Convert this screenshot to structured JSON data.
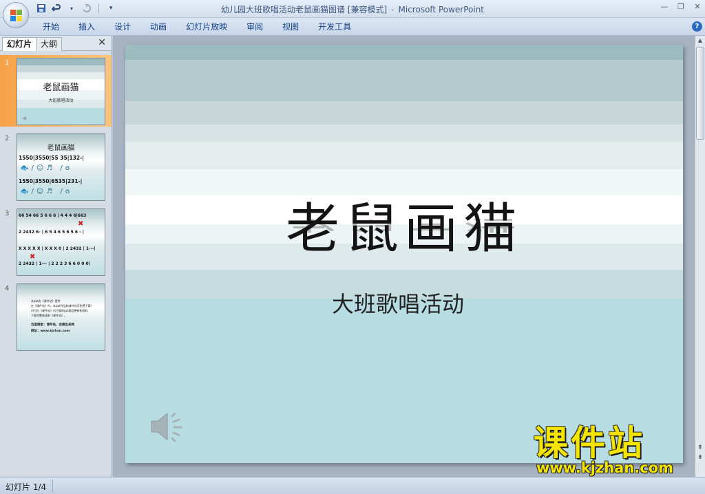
{
  "window": {
    "title": "幼儿园大班歌唱活动老鼠画猫图谱 [兼容模式]",
    "app_name": "Microsoft PowerPoint",
    "separator": "-"
  },
  "qat": {
    "customize_glyph": "▾"
  },
  "ribbon": {
    "tabs": [
      {
        "label": "开始"
      },
      {
        "label": "插入"
      },
      {
        "label": "设计"
      },
      {
        "label": "动画"
      },
      {
        "label": "幻灯片放映"
      },
      {
        "label": "审阅"
      },
      {
        "label": "视图"
      },
      {
        "label": "开发工具"
      }
    ],
    "help_glyph": "?"
  },
  "panel": {
    "tab_slides": "幻灯片",
    "tab_outline": "大纲",
    "close_glyph": "✕",
    "thumbnails": [
      {
        "number": "1",
        "title": "老鼠画猫",
        "subtitle": "大班歌唱活动",
        "selected": true
      },
      {
        "number": "2",
        "title": "老鼠画猫",
        "lines": [
          "1550|3550|55 35|132-|",
          "1550|3550|6535|231-|"
        ]
      },
      {
        "number": "3",
        "lines": [
          "66 54 66 5 6 6 6 | 4 4 4 6|663",
          "2 2432 6- | 6 5 4 6 5 6 5 6 - |",
          "X X X X X | X X X 0 | 2 2432 | 1---|",
          "2 2432 | 1--- | 2 2 2 3 6 6 0 0 0|"
        ]
      },
      {
        "number": "4",
        "lines": [
          "本ppt由《课件站》提供",
          "在《课件站》内，本ppt作品和课件均可免费下载！",
          "对日后《课件站》内下载的ppt都会更新和资料",
          "下载完整版请到《课件站》。",
          "百度搜索：课件站，会搜出来网",
          "网址：www.kjzhan.com"
        ]
      }
    ]
  },
  "slide": {
    "title": "老鼠画猫",
    "subtitle": "大班歌唱活动",
    "band_colors": [
      "#9dbcc0",
      "#b4cacd",
      "#c8d7da",
      "#d9e2e5",
      "#e4ecee",
      "#f1f6f7",
      "#ffffff",
      "#edf4f5",
      "#dde9eb",
      "#c6dde0",
      "#b7dde2"
    ]
  },
  "status": {
    "slide_counter": "幻灯片 1/4"
  },
  "watermark": {
    "text": "课件站",
    "url": "www.kjzhan.com"
  }
}
